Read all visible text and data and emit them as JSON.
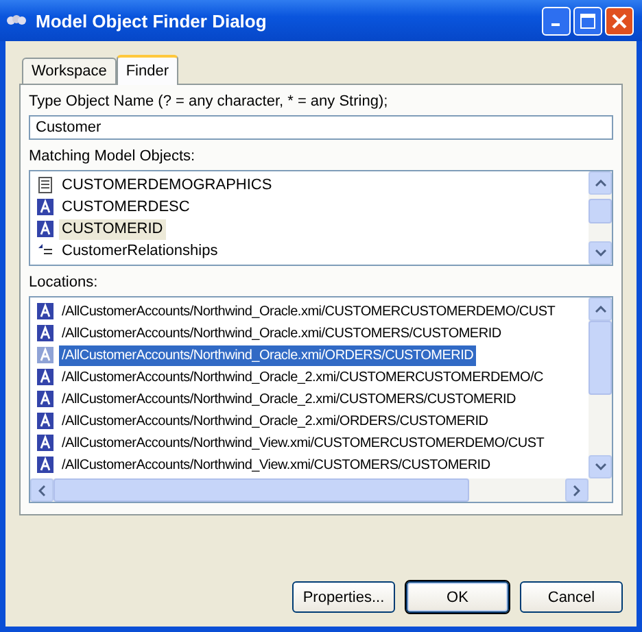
{
  "window": {
    "title": "Model Object Finder Dialog"
  },
  "tabs": [
    {
      "label": "Workspace",
      "selected": false
    },
    {
      "label": "Finder",
      "selected": true
    }
  ],
  "name_label": "Type Object Name (? = any character, * = any String);",
  "name_field": {
    "value": "Customer"
  },
  "objects_label": "Matching Model Objects:",
  "objects": [
    {
      "kind": "table",
      "label": "CUSTOMERDEMOGRAPHICS",
      "selected": false
    },
    {
      "kind": "column",
      "label": "CUSTOMERDESC",
      "selected": false
    },
    {
      "kind": "column",
      "label": "CUSTOMERID",
      "selected": true
    },
    {
      "kind": "relationship",
      "label": "CustomerRelationships",
      "selected": false
    }
  ],
  "locations_label": "Locations:",
  "locations": [
    {
      "label": "/AllCustomerAccounts/Northwind_Oracle.xmi/CUSTOMERCUSTOMERDEMO/CUST",
      "selected": false
    },
    {
      "label": "/AllCustomerAccounts/Northwind_Oracle.xmi/CUSTOMERS/CUSTOMERID",
      "selected": false
    },
    {
      "label": "/AllCustomerAccounts/Northwind_Oracle.xmi/ORDERS/CUSTOMERID",
      "selected": true
    },
    {
      "label": "/AllCustomerAccounts/Northwind_Oracle_2.xmi/CUSTOMERCUSTOMERDEMO/C",
      "selected": false
    },
    {
      "label": "/AllCustomerAccounts/Northwind_Oracle_2.xmi/CUSTOMERS/CUSTOMERID",
      "selected": false
    },
    {
      "label": "/AllCustomerAccounts/Northwind_Oracle_2.xmi/ORDERS/CUSTOMERID",
      "selected": false
    },
    {
      "label": "/AllCustomerAccounts/Northwind_View.xmi/CUSTOMERCUSTOMERDEMO/CUST",
      "selected": false
    },
    {
      "label": "/AllCustomerAccounts/Northwind_View.xmi/CUSTOMERS/CUSTOMERID",
      "selected": false
    }
  ],
  "buttons": [
    {
      "label": "Properties...",
      "default": false
    },
    {
      "label": "OK",
      "default": true
    },
    {
      "label": "Cancel",
      "default": false
    }
  ]
}
